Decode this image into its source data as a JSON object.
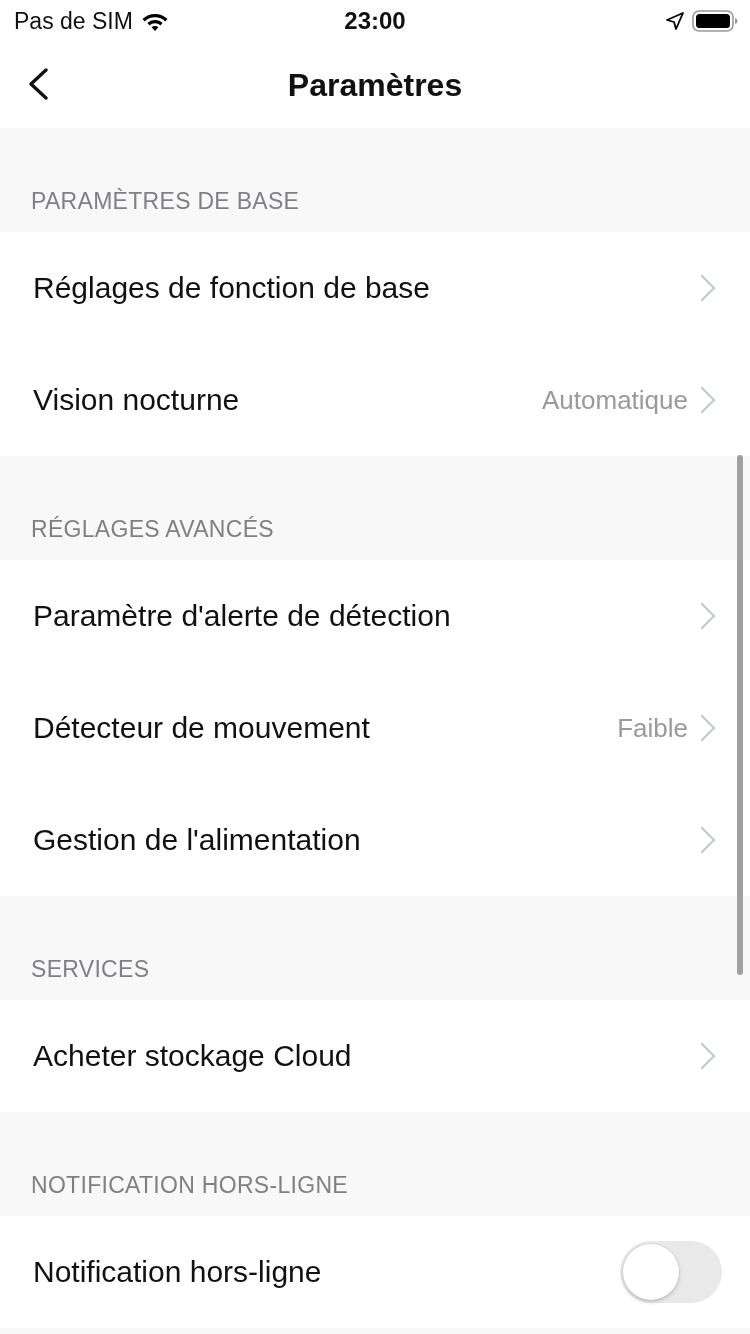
{
  "status_bar": {
    "carrier": "Pas de SIM",
    "time": "23:00"
  },
  "nav": {
    "title": "Paramètres"
  },
  "sections": [
    {
      "header": "PARAMÈTRES DE BASE",
      "rows": [
        {
          "kind": "link",
          "label": "Réglages de fonction de base"
        },
        {
          "kind": "link",
          "label": "Vision nocturne",
          "value": "Automatique"
        }
      ]
    },
    {
      "header": "RÉGLAGES AVANCÉS",
      "rows": [
        {
          "kind": "link",
          "label": "Paramètre d'alerte de détection"
        },
        {
          "kind": "link",
          "label": "Détecteur de mouvement",
          "value": "Faible"
        },
        {
          "kind": "link",
          "label": "Gestion de l'alimentation"
        }
      ]
    },
    {
      "header": "SERVICES",
      "rows": [
        {
          "kind": "link",
          "label": "Acheter stockage Cloud"
        }
      ]
    },
    {
      "header": "NOTIFICATION HORS-LIGNE",
      "rows": [
        {
          "kind": "toggle",
          "label": "Notification hors-ligne",
          "on": false
        }
      ]
    }
  ]
}
